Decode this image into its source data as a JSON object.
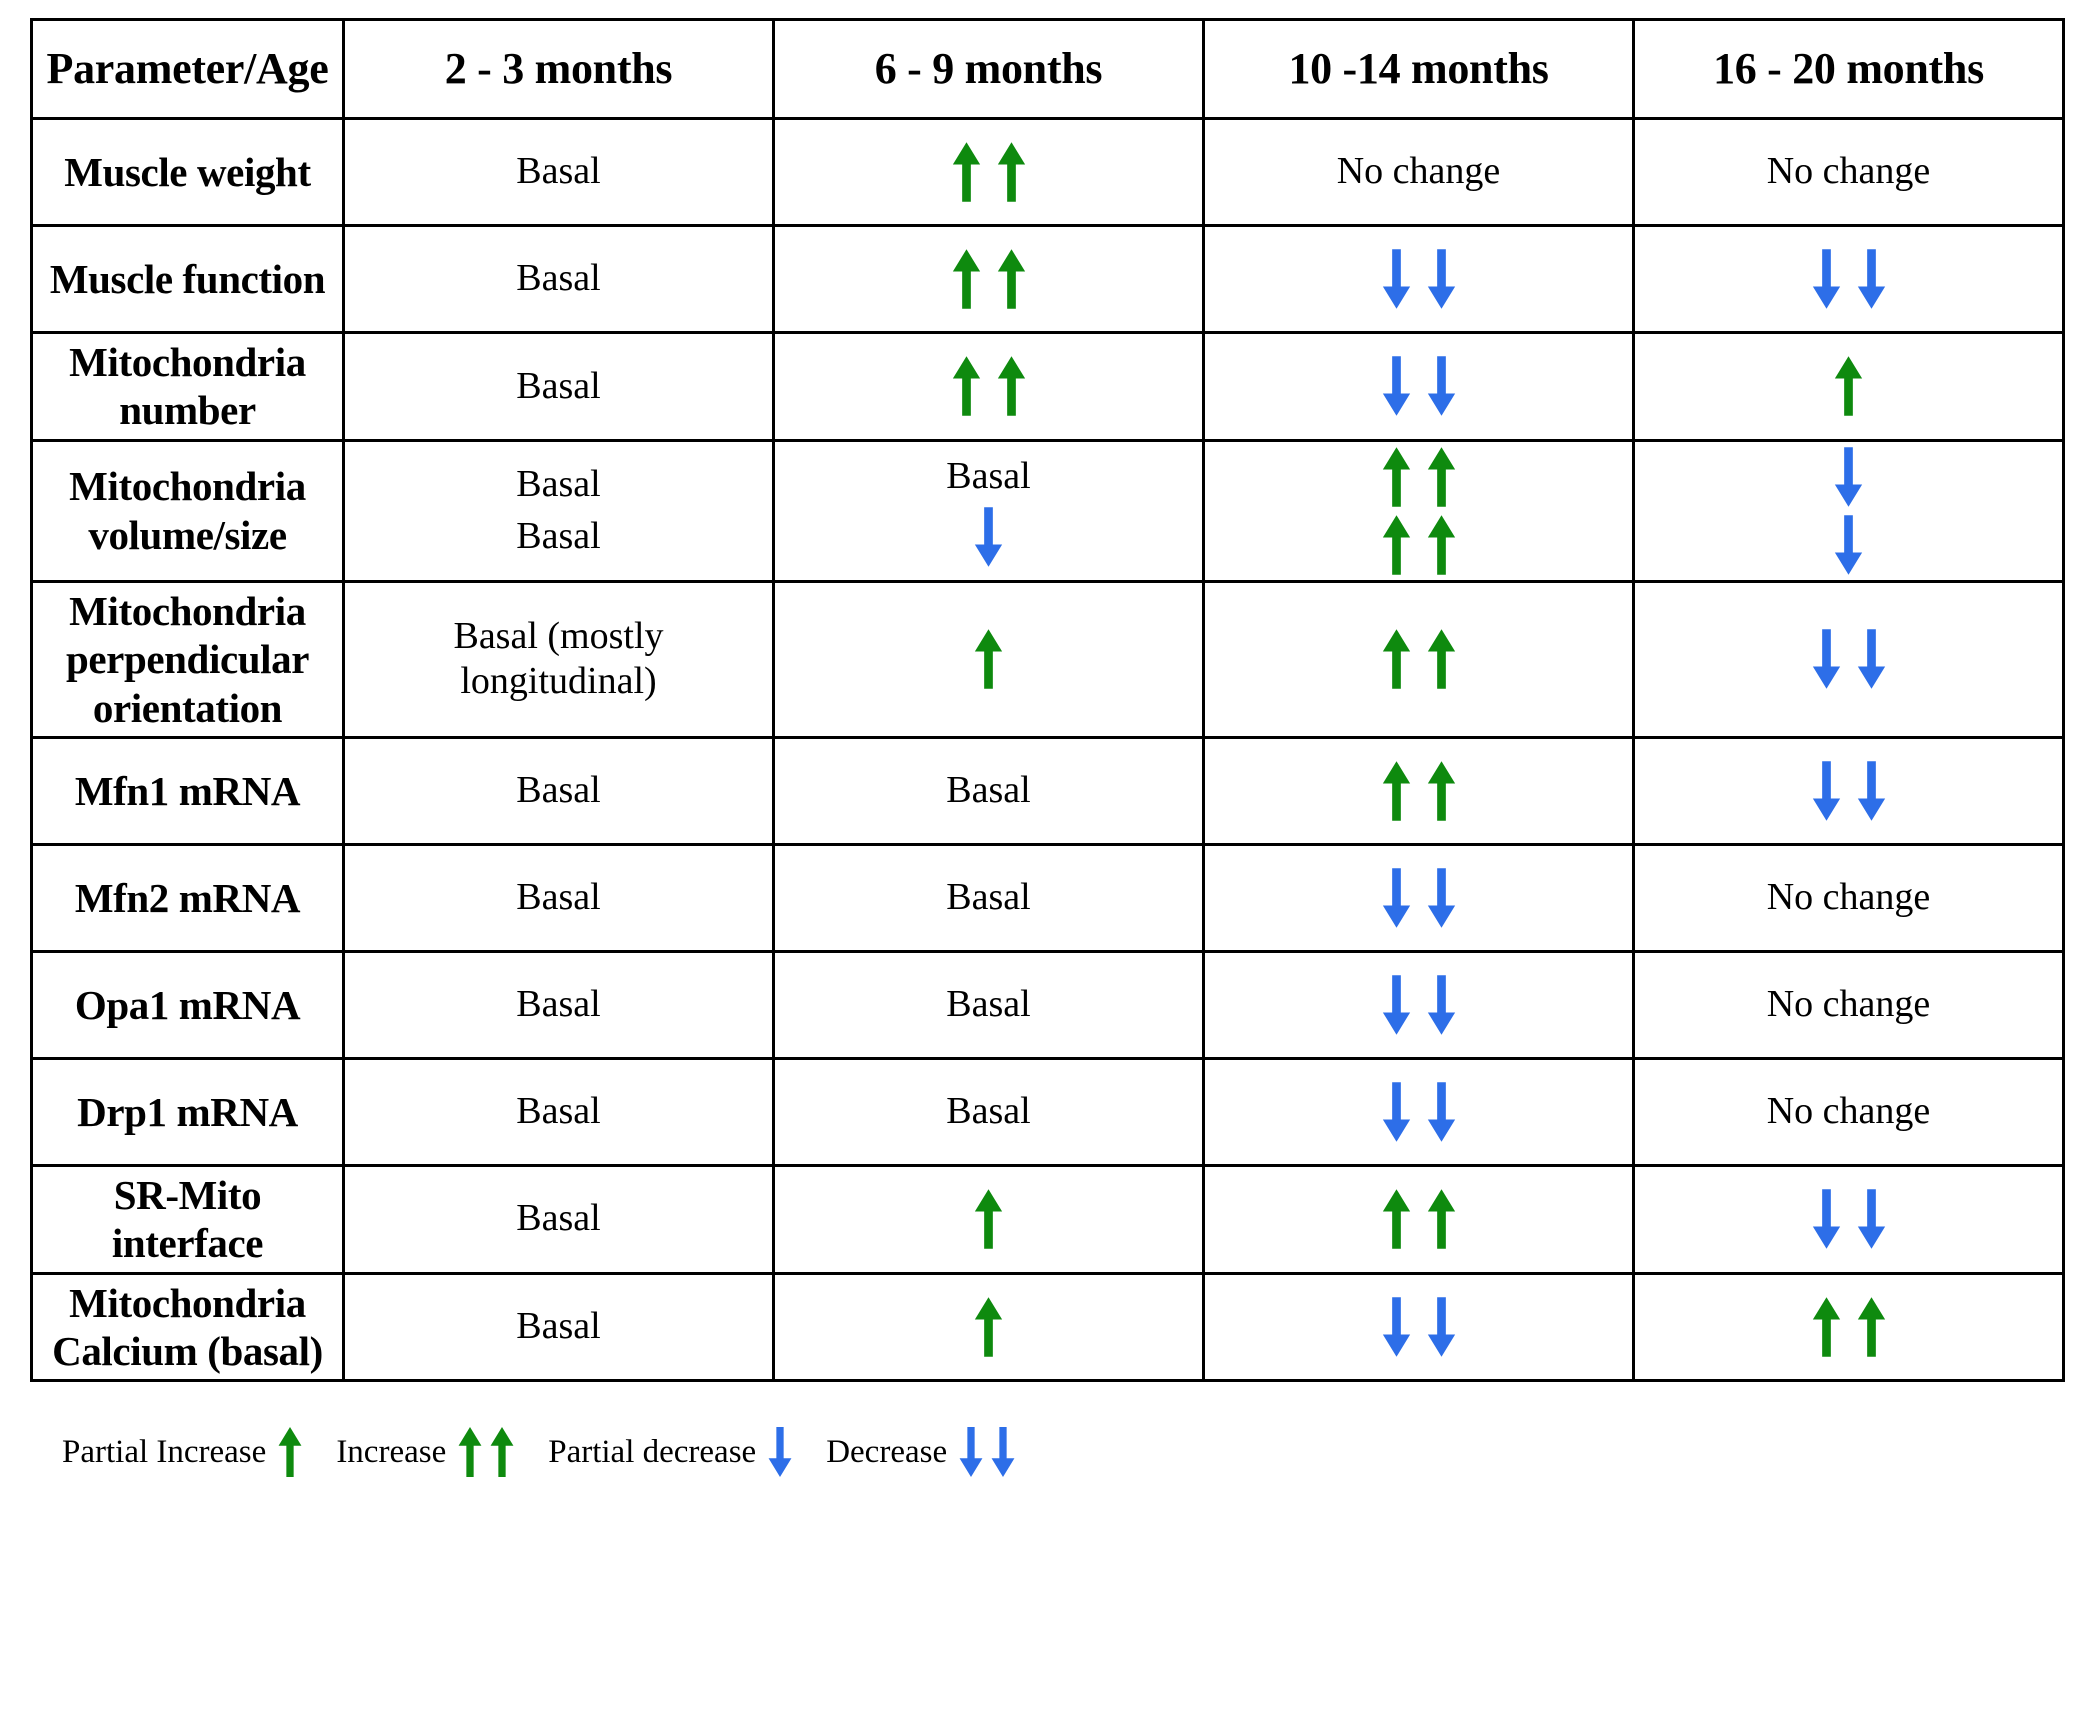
{
  "colors": {
    "increase": "#0E8A0E",
    "decrease": "#2D6EE8",
    "border": "#000000",
    "text": "#000000"
  },
  "table": {
    "headers": [
      "Parameter/Age",
      "2 - 3 months",
      "6 - 9 months",
      "10 -14 months",
      "16 - 20 months"
    ],
    "rows": [
      {
        "parameter": "Muscle weight",
        "cells": [
          {
            "lines": [
              {
                "text": "Basal"
              }
            ]
          },
          {
            "lines": [
              {
                "arrows": {
                  "dir": "up",
                  "count": 2
                }
              }
            ]
          },
          {
            "lines": [
              {
                "text": "No change"
              }
            ]
          },
          {
            "lines": [
              {
                "text": "No change"
              }
            ]
          }
        ]
      },
      {
        "parameter": "Muscle function",
        "cells": [
          {
            "lines": [
              {
                "text": "Basal"
              }
            ]
          },
          {
            "lines": [
              {
                "arrows": {
                  "dir": "up",
                  "count": 2
                }
              }
            ]
          },
          {
            "lines": [
              {
                "arrows": {
                  "dir": "down",
                  "count": 2
                }
              }
            ]
          },
          {
            "lines": [
              {
                "arrows": {
                  "dir": "down",
                  "count": 2
                }
              }
            ]
          }
        ]
      },
      {
        "parameter": "Mitochondria number",
        "cells": [
          {
            "lines": [
              {
                "text": "Basal"
              }
            ]
          },
          {
            "lines": [
              {
                "arrows": {
                  "dir": "up",
                  "count": 2
                }
              }
            ]
          },
          {
            "lines": [
              {
                "arrows": {
                  "dir": "down",
                  "count": 2
                }
              }
            ]
          },
          {
            "lines": [
              {
                "arrows": {
                  "dir": "up",
                  "count": 1
                }
              }
            ]
          }
        ]
      },
      {
        "parameter": "Mitochondria volume/size",
        "cells": [
          {
            "lines": [
              {
                "text": "Basal"
              },
              {
                "text": "Basal"
              }
            ]
          },
          {
            "lines": [
              {
                "text": "Basal"
              },
              {
                "arrows": {
                  "dir": "down",
                  "count": 1
                }
              }
            ]
          },
          {
            "lines": [
              {
                "arrows": {
                  "dir": "up",
                  "count": 2
                }
              },
              {
                "arrows": {
                  "dir": "up",
                  "count": 2
                }
              }
            ]
          },
          {
            "lines": [
              {
                "arrows": {
                  "dir": "down",
                  "count": 1
                }
              },
              {
                "arrows": {
                  "dir": "down",
                  "count": 1
                }
              }
            ]
          }
        ]
      },
      {
        "parameter": "Mitochondria perpendicular orientation",
        "cells": [
          {
            "lines": [
              {
                "text": "Basal (mostly longitudinal)"
              }
            ]
          },
          {
            "lines": [
              {
                "arrows": {
                  "dir": "up",
                  "count": 1
                }
              }
            ]
          },
          {
            "lines": [
              {
                "arrows": {
                  "dir": "up",
                  "count": 2
                }
              }
            ]
          },
          {
            "lines": [
              {
                "arrows": {
                  "dir": "down",
                  "count": 2
                }
              }
            ]
          }
        ]
      },
      {
        "parameter": "Mfn1 mRNA",
        "cells": [
          {
            "lines": [
              {
                "text": "Basal"
              }
            ]
          },
          {
            "lines": [
              {
                "text": "Basal"
              }
            ]
          },
          {
            "lines": [
              {
                "arrows": {
                  "dir": "up",
                  "count": 2
                }
              }
            ]
          },
          {
            "lines": [
              {
                "arrows": {
                  "dir": "down",
                  "count": 2
                }
              }
            ]
          }
        ]
      },
      {
        "parameter": "Mfn2 mRNA",
        "cells": [
          {
            "lines": [
              {
                "text": "Basal"
              }
            ]
          },
          {
            "lines": [
              {
                "text": "Basal"
              }
            ]
          },
          {
            "lines": [
              {
                "arrows": {
                  "dir": "down",
                  "count": 2
                }
              }
            ]
          },
          {
            "lines": [
              {
                "text": "No change"
              }
            ]
          }
        ]
      },
      {
        "parameter": "Opa1 mRNA",
        "cells": [
          {
            "lines": [
              {
                "text": "Basal"
              }
            ]
          },
          {
            "lines": [
              {
                "text": "Basal"
              }
            ]
          },
          {
            "lines": [
              {
                "arrows": {
                  "dir": "down",
                  "count": 2
                }
              }
            ]
          },
          {
            "lines": [
              {
                "text": "No change"
              }
            ]
          }
        ]
      },
      {
        "parameter": "Drp1 mRNA",
        "cells": [
          {
            "lines": [
              {
                "text": "Basal"
              }
            ]
          },
          {
            "lines": [
              {
                "text": "Basal"
              }
            ]
          },
          {
            "lines": [
              {
                "arrows": {
                  "dir": "down",
                  "count": 2
                }
              }
            ]
          },
          {
            "lines": [
              {
                "text": "No change"
              }
            ]
          }
        ]
      },
      {
        "parameter": "SR-Mito interface",
        "cells": [
          {
            "lines": [
              {
                "text": "Basal"
              }
            ]
          },
          {
            "lines": [
              {
                "arrows": {
                  "dir": "up",
                  "count": 1
                }
              }
            ]
          },
          {
            "lines": [
              {
                "arrows": {
                  "dir": "up",
                  "count": 2
                }
              }
            ]
          },
          {
            "lines": [
              {
                "arrows": {
                  "dir": "down",
                  "count": 2
                }
              }
            ]
          }
        ]
      },
      {
        "parameter": "Mitochondria Calcium (basal)",
        "cells": [
          {
            "lines": [
              {
                "text": "Basal"
              }
            ]
          },
          {
            "lines": [
              {
                "arrows": {
                  "dir": "up",
                  "count": 1
                }
              }
            ]
          },
          {
            "lines": [
              {
                "arrows": {
                  "dir": "down",
                  "count": 2
                }
              }
            ]
          },
          {
            "lines": [
              {
                "arrows": {
                  "dir": "up",
                  "count": 2
                }
              }
            ]
          }
        ]
      }
    ]
  },
  "legend": [
    {
      "label": "Partial Increase",
      "dir": "up",
      "count": 1
    },
    {
      "label": "Increase",
      "dir": "up",
      "count": 2
    },
    {
      "label": "Partial decrease",
      "dir": "down",
      "count": 1
    },
    {
      "label": "Decrease",
      "dir": "down",
      "count": 2
    }
  ]
}
